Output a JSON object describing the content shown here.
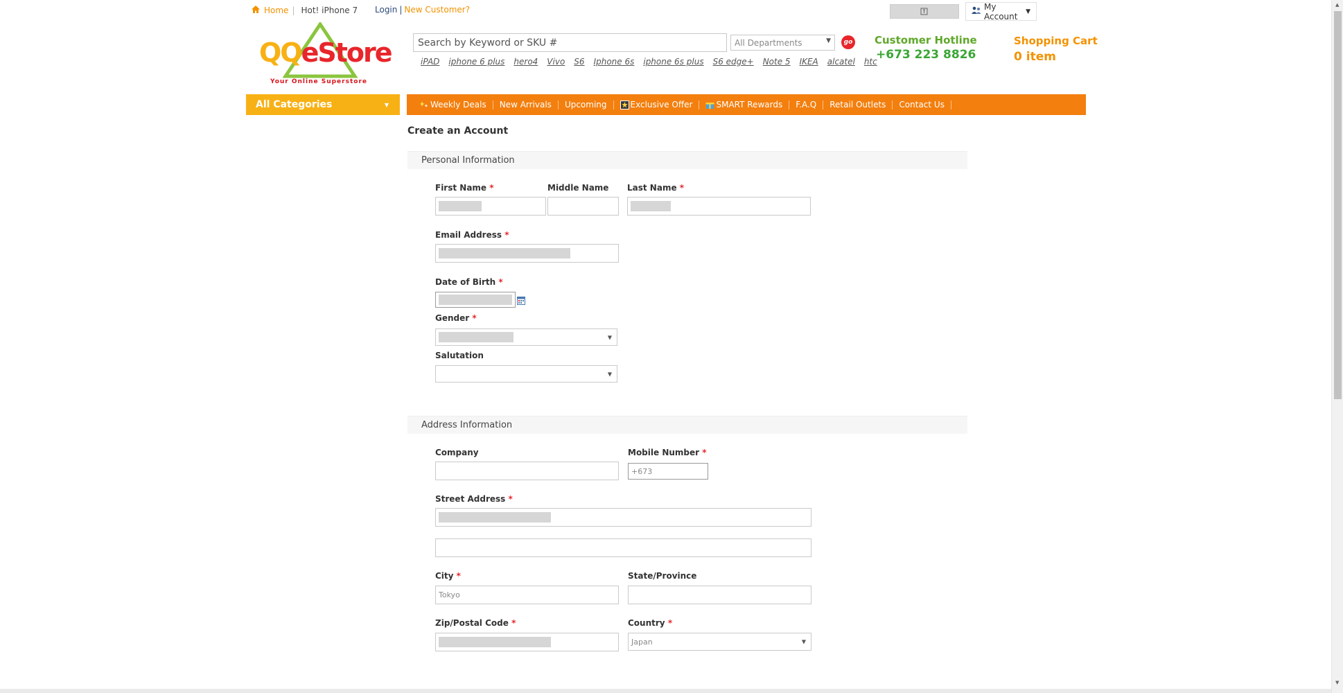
{
  "topbar": {
    "home": "Home",
    "hot": "Hot! iPhone 7",
    "login": "Login",
    "new_customer": "New Customer?",
    "my_account": "My Account"
  },
  "logo": {
    "brand": "QQeStore",
    "tagline": "Your Online Superstore"
  },
  "search": {
    "placeholder": "Search by Keyword or SKU #",
    "department": "All Departments",
    "go": "go",
    "quicklinks": [
      "iPAD",
      "iphone 6 plus",
      "hero4",
      "Vivo",
      "S6",
      "Iphone 6s",
      "iphone 6s plus",
      "S6 edge+",
      "Note 5",
      "IKEA",
      "alcatel",
      "htc"
    ]
  },
  "hotline": {
    "label": "Customer Hotline",
    "number": "+673 223 8826"
  },
  "cart": {
    "label": "Shopping Cart",
    "count": "0 item"
  },
  "nav": {
    "categories": "All Categories",
    "items": [
      "Weekly Deals",
      "New Arrivals",
      "Upcoming",
      "Exclusive Offer",
      "SMART Rewards",
      "F.A.Q",
      "Retail Outlets",
      "Contact Us"
    ]
  },
  "form": {
    "title": "Create an Account",
    "personal_section": "Personal Information",
    "address_section": "Address Information",
    "first_name": "First Name",
    "middle_name": "Middle Name",
    "last_name": "Last Name",
    "email": "Email Address",
    "dob": "Date of Birth",
    "gender": "Gender",
    "salutation": "Salutation",
    "company": "Company",
    "mobile": "Mobile Number",
    "mobile_value": "+673",
    "street": "Street Address",
    "city": "City",
    "city_value": "Tokyo",
    "state": "State/Province",
    "zip": "Zip/Postal Code",
    "country": "Country",
    "country_value": "Japan",
    "required_mark": "*"
  },
  "colors": {
    "orange": "#f37f0e",
    "yellow": "#f8b114",
    "green": "#3aa635",
    "red": "#e8262b"
  }
}
